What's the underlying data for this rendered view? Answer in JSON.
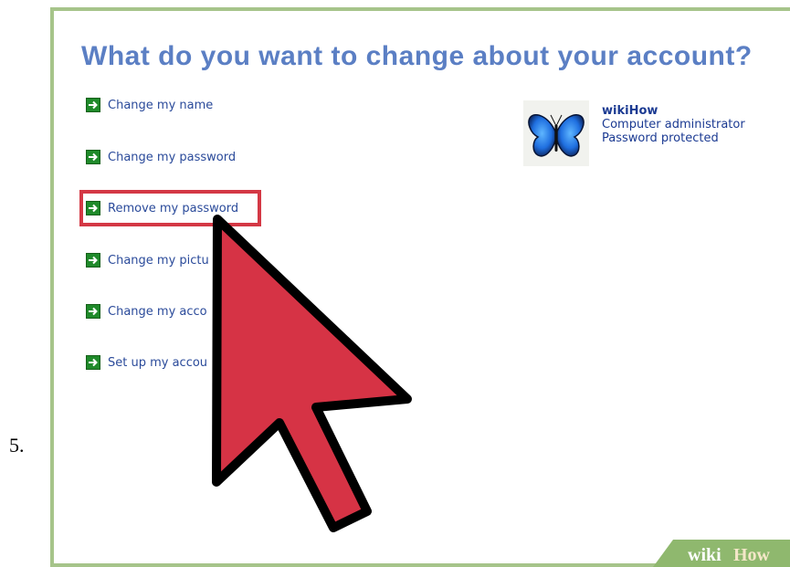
{
  "step_number": "5.",
  "title": "What do you want to change about your account?",
  "tasks": [
    {
      "label": "Change my name"
    },
    {
      "label": "Change my password"
    },
    {
      "label": "Remove my password"
    },
    {
      "label": "Change my pictu"
    },
    {
      "label": "Change my acco"
    },
    {
      "label": "Set up my accou"
    }
  ],
  "highlighted_task": "Remove my password",
  "account": {
    "name": "wikiHow",
    "role": "Computer administrator",
    "status": "Password protected",
    "picture_icon": "butterfly-icon"
  },
  "watermark": {
    "part1": "wiki",
    "part2": "How"
  },
  "colors": {
    "title": "#5b7fc4",
    "link": "#2a4a9a",
    "frame": "#a6c48a",
    "highlight": "#d43845",
    "cursor": "#d63345",
    "arrow_icon": "#1f8a2a"
  }
}
